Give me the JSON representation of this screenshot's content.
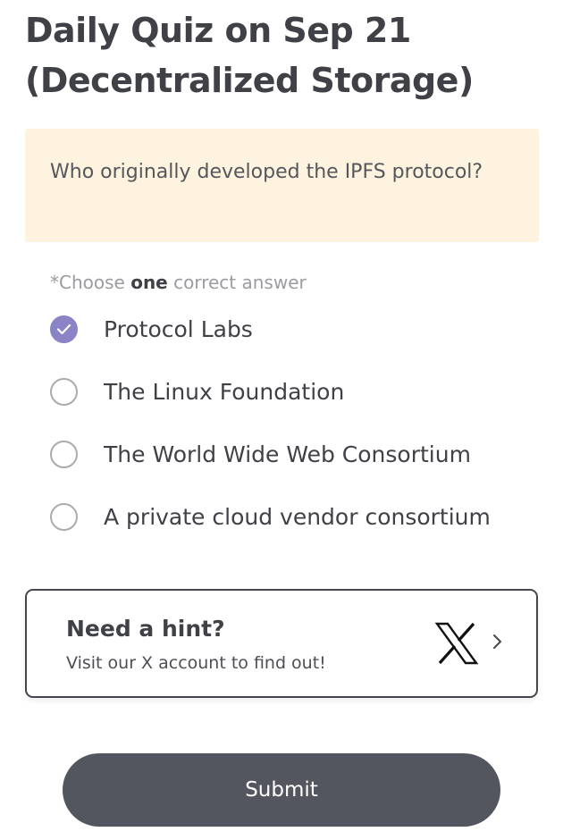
{
  "quiz": {
    "title": "Daily Quiz on Sep 21 (Decentralized Storage)",
    "question": "Who originally developed the IPFS protocol?",
    "instruction": {
      "prefix": "*Choose ",
      "emphasis": "one",
      "suffix": " correct answer"
    },
    "options": [
      {
        "label": "Protocol Labs",
        "selected": true
      },
      {
        "label": "The Linux Foundation",
        "selected": false
      },
      {
        "label": "The World Wide Web Consortium",
        "selected": false
      },
      {
        "label": "A private cloud vendor consortium",
        "selected": false
      }
    ]
  },
  "hint": {
    "title": "Need a hint?",
    "subtitle": "Visit our X account to find out!",
    "icon": "x-logo-icon",
    "arrow_icon": "chevron-right-icon"
  },
  "submit": {
    "label": "Submit"
  },
  "colors": {
    "question_background": "#fdf3df",
    "selected_radio": "#8a84c6",
    "submit_background": "#53565e"
  }
}
